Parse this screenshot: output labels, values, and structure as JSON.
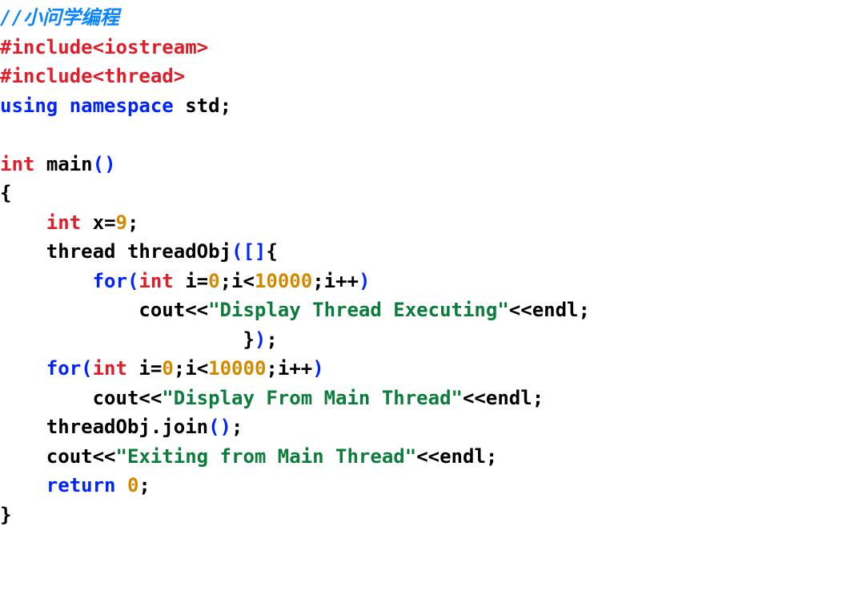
{
  "code": {
    "author_comment": "//小问学编程",
    "include1": "#include<iostream>",
    "include2": "#include<thread>",
    "using_kw": "using",
    "namespace_kw": "namespace",
    "std_ident": "std",
    "semicolon": ";",
    "int_type": "int",
    "main_fn": "main",
    "lparen": "(",
    "rparen": ")",
    "lbrace": "{",
    "rbrace": "}",
    "lbracket": "[",
    "rbracket": "]",
    "x_ident": "x",
    "eq": "=",
    "nine": "9",
    "thread_ident": "thread",
    "threadObj_ident": "threadObj",
    "for_kw": "for",
    "i_ident": "i",
    "zero": "0",
    "lt": "<",
    "tenk": "10000",
    "ipp": "i++",
    "cout_ident": "cout",
    "ltlt": "<<",
    "str_display_thread_exec": "\"Display Thread Executing\"",
    "endl_ident": "endl",
    "str_display_main": "\"Display From Main Thread\"",
    "dot": ".",
    "join_fn": "join",
    "str_exiting": "\"Exiting from Main Thread\"",
    "return_kw": "return",
    "indent1": "    ",
    "indent2": "        ",
    "indent3": "            ",
    "indent_brace_close": "                     "
  }
}
